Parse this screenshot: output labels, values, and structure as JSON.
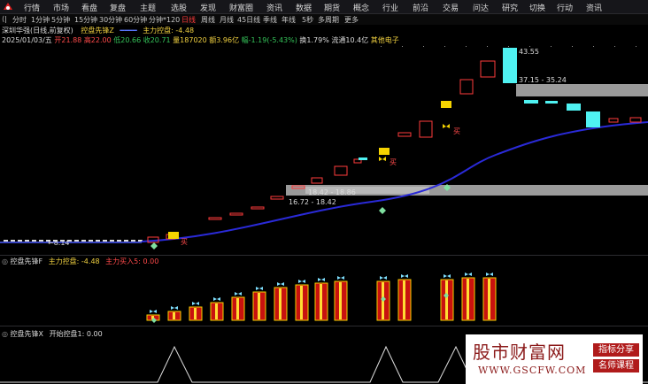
{
  "menu": [
    "行情",
    "市场",
    "看盘",
    "复盘",
    "主题",
    "选股",
    "发现",
    "财富圈",
    "资讯",
    "数据",
    "期货",
    "概念",
    "行业",
    "前沿",
    "交易",
    "问达",
    "研究",
    "切换",
    "行动",
    "资讯"
  ],
  "periods": [
    "分时",
    "1分钟",
    "5分钟",
    "15分钟",
    "30分钟",
    "60分钟",
    "分钟*120",
    "日线",
    "周线",
    "月线",
    "45日线",
    "季线",
    "年线",
    "5秒",
    "多周期",
    "更多"
  ],
  "active_period": "日线",
  "stock": {
    "title": "深圳华强(日线,前复权)",
    "indicator": "控盘先锋Z",
    "extra": "主力控盘: -4.48"
  },
  "quote": {
    "date": "2025/01/03/五",
    "open": "开21.88",
    "high": "高22.00",
    "low": "低20.66",
    "close": "收20.71",
    "volume": "量187020",
    "amount": "额3.96亿",
    "change": "幅-1.19(-5.43%)",
    "turnover": "换1.79%",
    "float_cap": "流通10.4亿",
    "sector": "其他电子"
  },
  "price_labels": {
    "p1": "43.55",
    "p2": "37.15 - 35.24",
    "p3": "18.42 - 18.86",
    "p4": "16.72 - 18.42",
    "p5": "8.14"
  },
  "signal_labels": [
    "买",
    "买",
    "买",
    "买"
  ],
  "panel2": {
    "title": "控盘先锋F",
    "field1": "主力控盘: -4.48",
    "field2": "主力买入5: 0.00"
  },
  "panel3": {
    "title": "控盘先锋X",
    "field1": "开始控盘1: 0.00"
  },
  "ad": {
    "site": "股市财富网",
    "url": "WWW.GSCFW.COM",
    "tag1": "指标分享",
    "tag2": "名师课程"
  },
  "colors": {
    "up": "#ff3b3b",
    "down": "#4ff2f2",
    "ma": "#2a2ad8",
    "gold": "#f5d300",
    "bar": "#c8120f"
  }
}
